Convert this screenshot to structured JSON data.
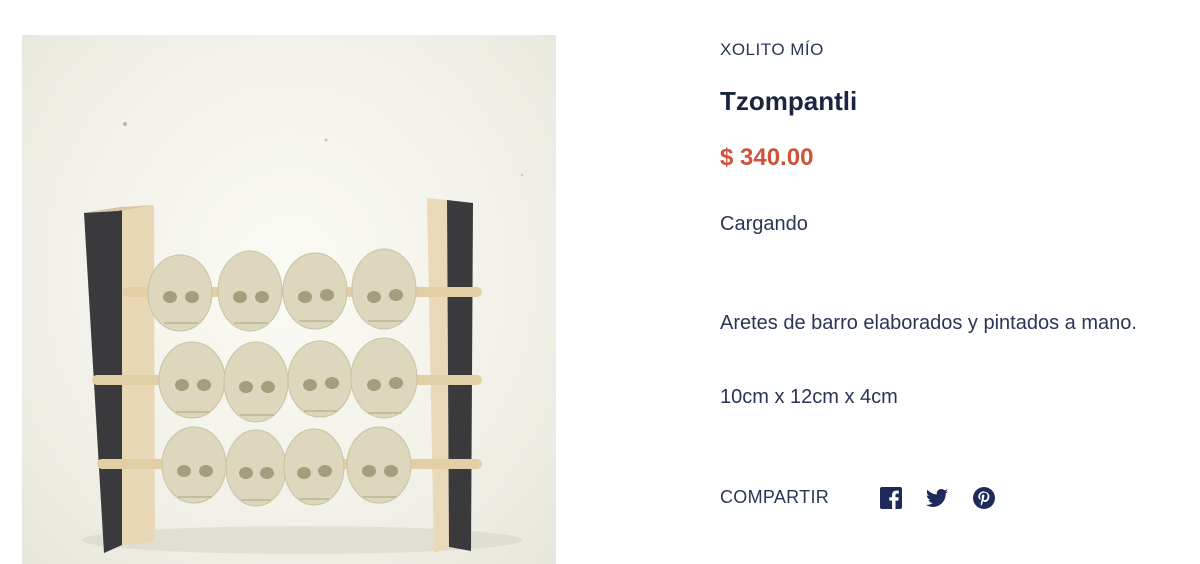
{
  "product": {
    "vendor": "XOLITO MÍO",
    "title": "Tzompantli",
    "price": "$ 340.00",
    "status": "Cargando",
    "description": "Aretes de barro elaborados y pintados a mano.",
    "dimensions": "10cm x 12cm x 4cm",
    "image_icon": "product-photo-tzompantli"
  },
  "share": {
    "label": "COMPARTIR",
    "icons": [
      "facebook-icon",
      "twitter-icon",
      "pinterest-icon"
    ]
  },
  "colors": {
    "text": "#2a3556",
    "price": "#d0523c",
    "social": "#1f2a5a"
  }
}
